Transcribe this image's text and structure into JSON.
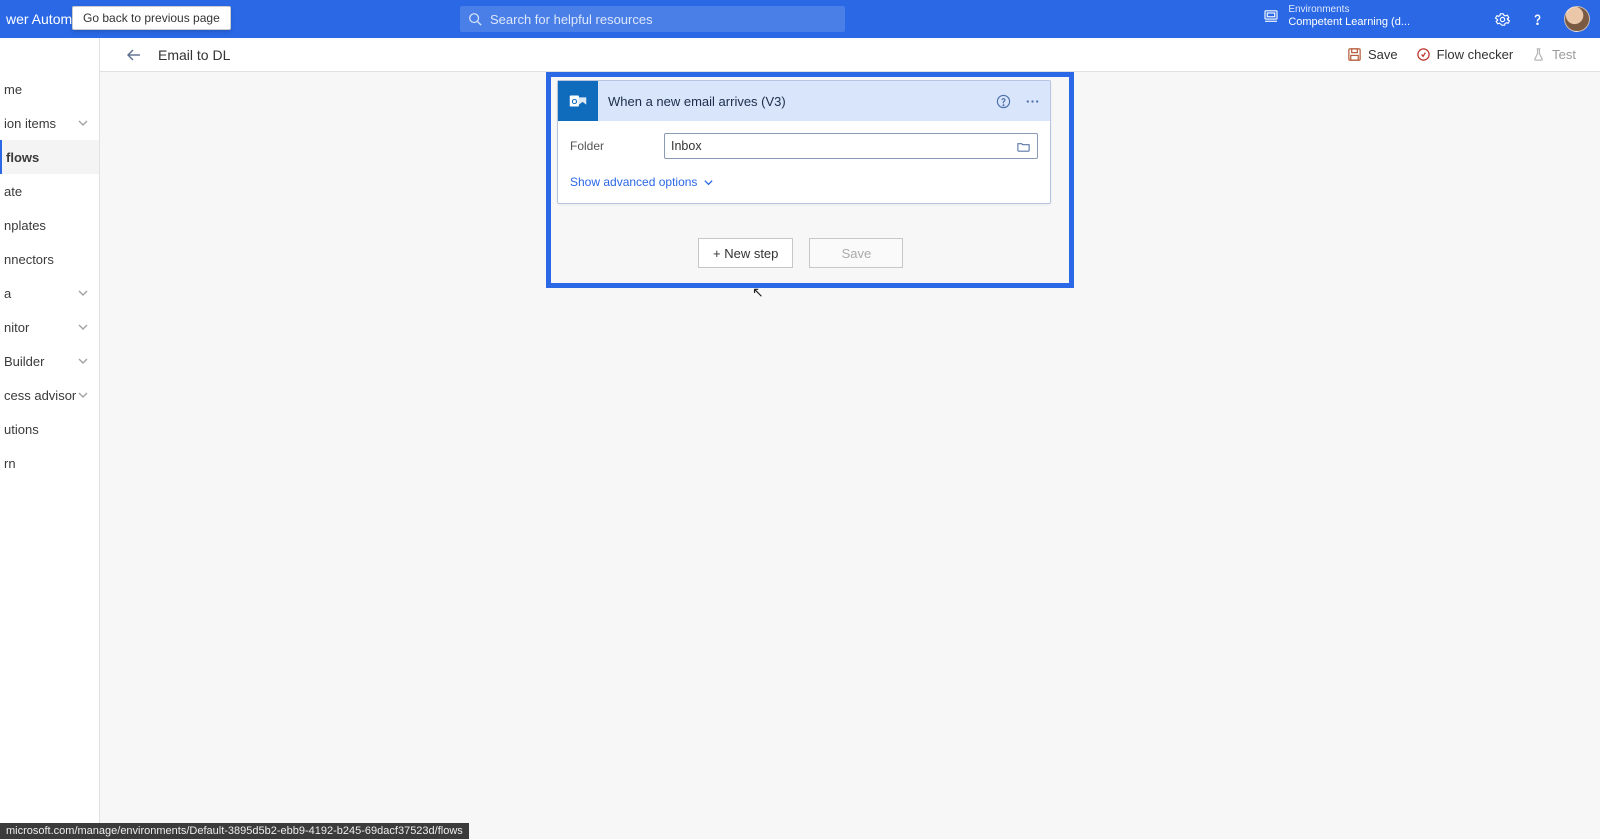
{
  "brand": "wer Automa",
  "tooltip": "Go back to previous page",
  "search_placeholder": "Search for helpful resources",
  "env_label": "Environments",
  "env_name": "Competent Learning (d...",
  "sidebar": {
    "items": [
      {
        "label": "me",
        "chev": false,
        "active": false
      },
      {
        "label": "ion items",
        "chev": true,
        "active": false
      },
      {
        "label": "flows",
        "chev": false,
        "active": true
      },
      {
        "label": "ate",
        "chev": false,
        "active": false
      },
      {
        "label": "nplates",
        "chev": false,
        "active": false
      },
      {
        "label": "nnectors",
        "chev": false,
        "active": false
      },
      {
        "label": "a",
        "chev": true,
        "active": false
      },
      {
        "label": "nitor",
        "chev": true,
        "active": false
      },
      {
        "label": "Builder",
        "chev": true,
        "active": false
      },
      {
        "label": "cess advisor",
        "chev": true,
        "active": false
      },
      {
        "label": "utions",
        "chev": false,
        "active": false
      },
      {
        "label": "rn",
        "chev": false,
        "active": false
      }
    ]
  },
  "cmdbar": {
    "title": "Email to DL",
    "save": "Save",
    "flow_checker": "Flow checker",
    "test": "Test"
  },
  "card": {
    "title": "When a new email arrives (V3)",
    "folder_label": "Folder",
    "folder_value": "Inbox",
    "advanced": "Show advanced options"
  },
  "actions": {
    "new_step": "+ New step",
    "save": "Save"
  },
  "status_url": "microsoft.com/manage/environments/Default-3895d5b2-ebb9-4192-b245-69dacf37523d/flows"
}
